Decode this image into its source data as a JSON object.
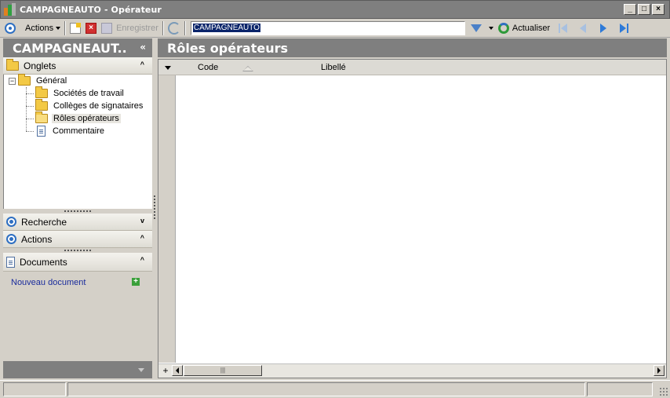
{
  "window": {
    "title": "CAMPAGNEAUTO  -  Opérateur",
    "minimize": "_",
    "maximize": "□",
    "close": "×"
  },
  "toolbar": {
    "actions_label": "Actions",
    "save_label": "Enregistrer",
    "search_value": "CAMPAGNEAUTO",
    "refresh_label": "Actualiser",
    "delete_glyph": "×"
  },
  "left_panel": {
    "title": "CAMPAGNEAUT..",
    "collapse_glyph": "«",
    "tabs_section": {
      "label": "Onglets",
      "chevron": "^",
      "tree": {
        "root": {
          "label": "Général",
          "expander": "−"
        },
        "children": [
          {
            "label": "Sociétés de travail"
          },
          {
            "label": "Collèges de signataires"
          },
          {
            "label": "Rôles opérateurs"
          },
          {
            "label": "Commentaire"
          }
        ]
      }
    },
    "search_section": {
      "label": "Recherche",
      "chevron": "v"
    },
    "actions_section": {
      "label": "Actions",
      "chevron": "^"
    },
    "documents_section": {
      "label": "Documents",
      "chevron": "^",
      "new_document_link": "Nouveau document",
      "add_glyph": "+"
    }
  },
  "main": {
    "title": "Rôles opérateurs",
    "grid": {
      "columns": [
        "Code",
        "Libellé"
      ],
      "rows": [],
      "add_glyph": "+",
      "scroll_thumb": "|||"
    }
  }
}
